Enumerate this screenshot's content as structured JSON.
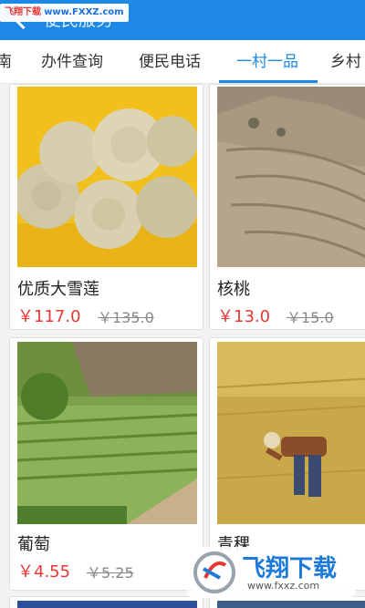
{
  "header": {
    "title": "便民服务"
  },
  "watermark": {
    "site_name": "飞翔下载",
    "site_url": "www.FXXZ.com",
    "brand_bottom": "飞翔下载",
    "url_bottom": "www.fxxz.com"
  },
  "tabs": [
    {
      "label": "南"
    },
    {
      "label": "办件查询"
    },
    {
      "label": "便民电话"
    },
    {
      "label": "一村一品",
      "active": true
    },
    {
      "label": "乡村"
    }
  ],
  "products": [
    {
      "name": "优质大雪莲",
      "price": "￥117.0",
      "original_price": "￥135.0",
      "image": "snow-lotus-photo"
    },
    {
      "name": "核桃",
      "price": "￥13.0",
      "original_price": "￥15.0",
      "image": "walnut-terrace-photo"
    },
    {
      "name": "葡萄",
      "price": "￥4.55",
      "original_price": "￥5.25",
      "image": "grape-field-photo"
    },
    {
      "name": "青稞",
      "price": "",
      "original_price": "",
      "image": "highland-barley-photo"
    }
  ],
  "colors": {
    "primary": "#1e88e5",
    "price_red": "#e53935"
  }
}
